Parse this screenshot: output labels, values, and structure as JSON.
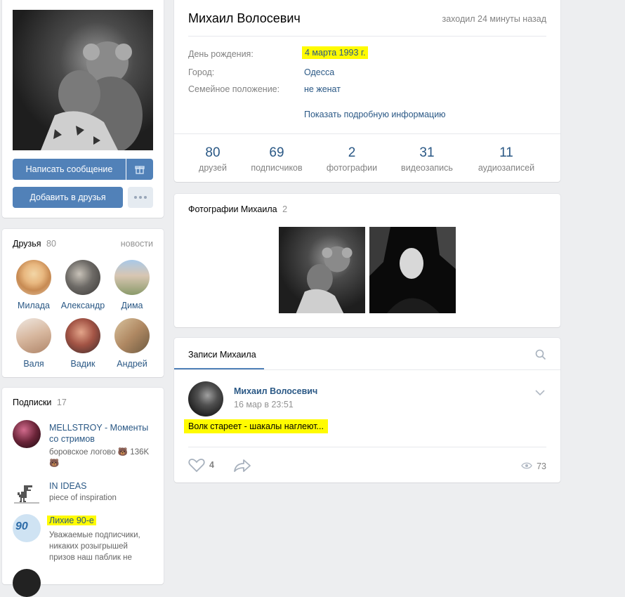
{
  "profile": {
    "name": "Михаил Волосевич",
    "last_seen": "заходил 24 минуты назад",
    "info": [
      {
        "label": "День рождения:",
        "value": "4 марта 1993 г."
      },
      {
        "label": "Город:",
        "value": "Одесса"
      },
      {
        "label": "Семейное положение:",
        "value": "не женат"
      }
    ],
    "show_more": "Показать подробную информацию"
  },
  "actions": {
    "message": "Написать сообщение",
    "add_friend": "Добавить в друзья"
  },
  "stats": [
    {
      "num": "80",
      "label": "друзей"
    },
    {
      "num": "69",
      "label": "подписчиков"
    },
    {
      "num": "2",
      "label": "фотографии"
    },
    {
      "num": "31",
      "label": "видеозапись"
    },
    {
      "num": "11",
      "label": "аудиозаписей"
    }
  ],
  "friends": {
    "title": "Друзья",
    "count": "80",
    "news": "новости",
    "items": [
      "Милада",
      "Александр",
      "Дима",
      "Валя",
      "Вадик",
      "Андрей"
    ]
  },
  "subs": {
    "title": "Подписки",
    "count": "17",
    "items": [
      {
        "name": "MELLSTROY - Моменты со стримов",
        "desc": "боровское логово 🐻 136K 🐻"
      },
      {
        "name": "IN IDEAS",
        "desc": "piece of inspiration"
      },
      {
        "name": "Лихие 90-е",
        "desc": "Уважаемые подписчики, никаких розыгрышей призов наш паблик не"
      }
    ]
  },
  "photos": {
    "title": "Фотографии Михаила",
    "count": "2"
  },
  "wall": {
    "tab": "Записи Михаила",
    "post": {
      "author": "Михаил Волосевич",
      "date": "16 мар в 23:51",
      "text": "Волк стареет - шакалы наглеют...",
      "likes": "4",
      "views": "73"
    }
  }
}
